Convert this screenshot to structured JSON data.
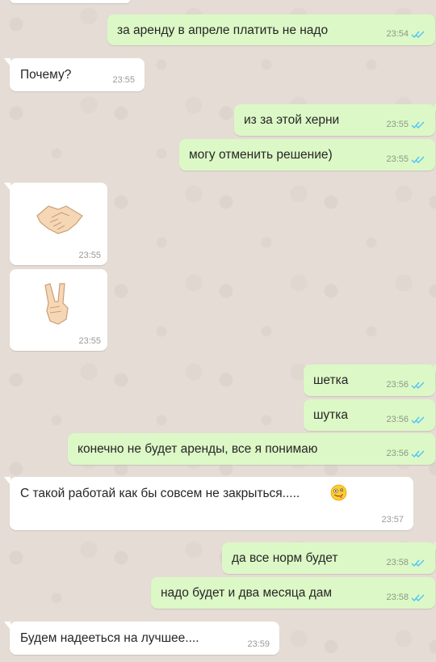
{
  "messages": [
    {
      "id": "m1",
      "dir": "out",
      "text": "за аренду в апреле платить не надо",
      "time": "23:54",
      "status": "read"
    },
    {
      "id": "m2",
      "dir": "in",
      "text": "Почему?",
      "time": "23:55"
    },
    {
      "id": "m3",
      "dir": "out",
      "text": "из за этой херни",
      "time": "23:55",
      "status": "read"
    },
    {
      "id": "m4",
      "dir": "out",
      "text": "могу отменить решение)",
      "time": "23:55",
      "status": "read"
    },
    {
      "id": "m5",
      "dir": "in",
      "sticker": "handshake-emoji",
      "time": "23:55"
    },
    {
      "id": "m6",
      "dir": "in",
      "sticker": "victory-hand-emoji",
      "time": "23:55"
    },
    {
      "id": "m7",
      "dir": "out",
      "text": "шетка",
      "time": "23:56",
      "status": "read"
    },
    {
      "id": "m8",
      "dir": "out",
      "text": "шутка",
      "time": "23:56",
      "status": "read"
    },
    {
      "id": "m9",
      "dir": "out",
      "text": "конечно не будет аренды, все я понимаю",
      "time": "23:56",
      "status": "read"
    },
    {
      "id": "m10",
      "dir": "in",
      "text": "С такой работай как бы совсем не закрыться.....",
      "emoji": "zany-face-emoji",
      "time": "23:57"
    },
    {
      "id": "m11",
      "dir": "out",
      "text": "да все норм будет",
      "time": "23:58",
      "status": "read"
    },
    {
      "id": "m12",
      "dir": "out",
      "text": "надо будет и два месяца дам",
      "time": "23:58",
      "status": "read"
    },
    {
      "id": "m13",
      "dir": "in",
      "text": "Будем надееться на лучшее....",
      "time": "23:59"
    }
  ],
  "colors": {
    "outgoing": "#dcf8c6",
    "incoming": "#ffffff",
    "background": "#e5ddd5",
    "read_ticks": "#4fc3f7"
  }
}
